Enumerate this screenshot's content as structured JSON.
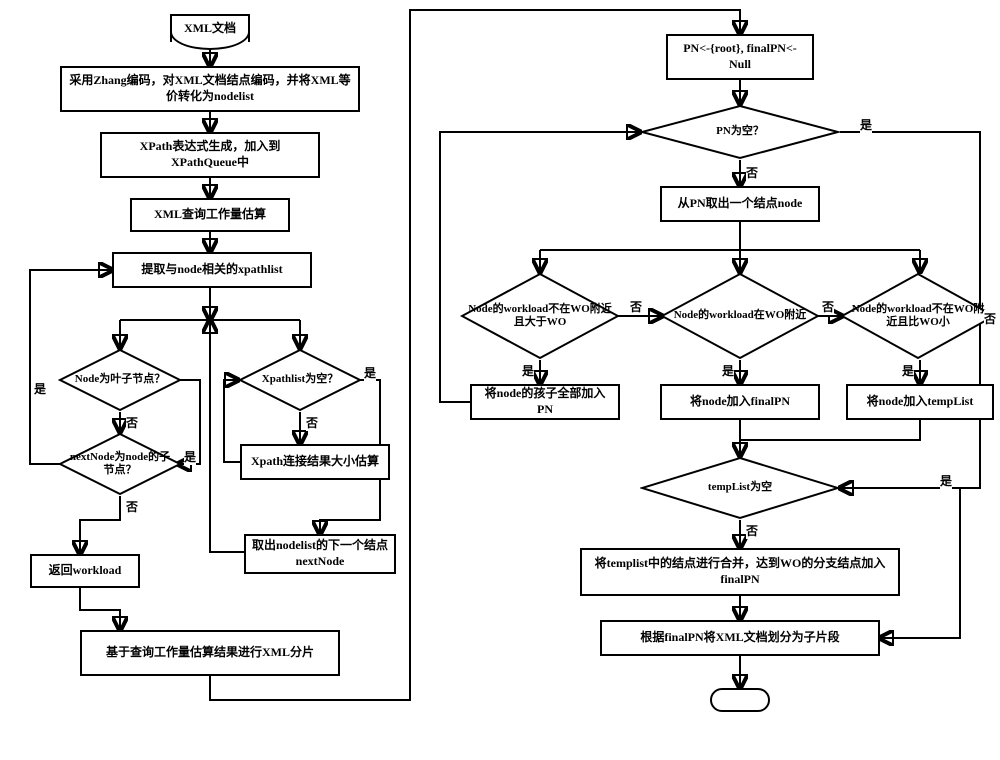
{
  "nodes": {
    "start": "XML文档",
    "encode": "采用Zhang编码，对XML文档结点编码，并将XML等价转化为nodelist",
    "xpathgen": "XPath表达式生成，加入到XPathQueue中",
    "workload_est": "XML查询工作量估算",
    "extract": "提取与node相关的xpathlist",
    "leaf_q": "Node为叶子节点？",
    "child_q": "nextNode为node的子节点？",
    "xpathlist_empty_q": "Xpathlist为空？",
    "join_est": "Xpath连接结果大小估算",
    "next_node": "取出nodelist的下一个结点nextNode",
    "ret_workload": "返回workload",
    "shard": "基于查询工作量估算结果进行XML分片",
    "pn_init": "PN<-{root}, finalPN<-Null",
    "pn_empty_q": "PN为空？",
    "take_node": "从PN取出一个结点node",
    "w_gt_q": "Node的workload不在WO附近且大于WO",
    "w_near_q": "Node的workload在WO附近",
    "w_lt_q": "Node的workload不在WO附近且比WO小",
    "add_children": "将node的孩子全部加入PN",
    "add_finalpn": "将node加入finalPN",
    "add_templist": "将node加入tempList",
    "templist_empty_q": "tempList为空",
    "merge": "将templist中的结点进行合并，达到WO的分支结点加入finalPN",
    "partition": "根据finalPN将XML文档划分为子片段"
  },
  "labels": {
    "yes": "是",
    "no": "否"
  }
}
